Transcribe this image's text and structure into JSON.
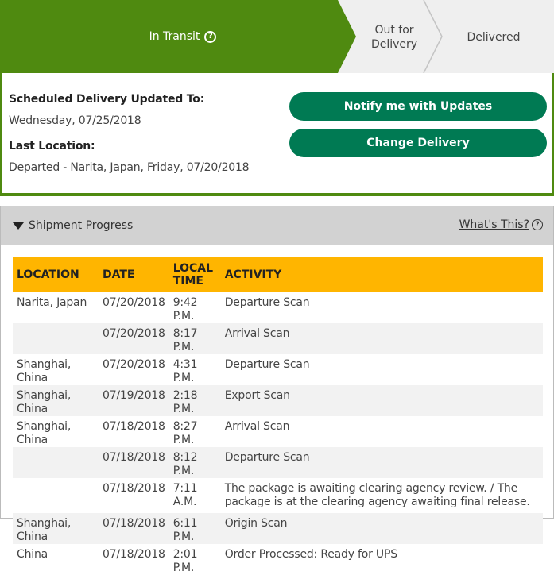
{
  "stepper": {
    "steps": [
      {
        "label": "In Transit",
        "state": "active"
      },
      {
        "label": "Out for Delivery",
        "line1": "Out for",
        "line2": "Delivery",
        "state": "pending"
      },
      {
        "label": "Delivered",
        "state": "pending"
      }
    ],
    "active_color": "#4f8a10",
    "pending_color": "#efefef"
  },
  "delivery": {
    "scheduled_label": "Scheduled Delivery Updated To:",
    "scheduled_value": "Wednesday, 07/25/2018",
    "last_location_label": "Last Location:",
    "last_location_value": "Departed - Narita, Japan, Friday, 07/20/2018",
    "notify_button": "Notify me with Updates",
    "change_button": "Change Delivery",
    "button_color": "#007a53"
  },
  "progress": {
    "title": "Shipment Progress",
    "whats_this": "What's This?",
    "columns": {
      "location": "LOCATION",
      "date": "DATE",
      "time_line1": "LOCAL",
      "time_line2": "TIME",
      "activity": "ACTIVITY"
    },
    "header_color": "#ffb500",
    "rows": [
      {
        "location": "Narita, Japan",
        "date": "07/20/2018",
        "time": "9:42 P.M.",
        "activity": "Departure Scan"
      },
      {
        "location": "",
        "date": "07/20/2018",
        "time": "8:17 P.M.",
        "activity": "Arrival Scan"
      },
      {
        "location": "Shanghai, China",
        "date": "07/20/2018",
        "time": "4:31 P.M.",
        "activity": "Departure Scan"
      },
      {
        "location": "Shanghai, China",
        "date": "07/19/2018",
        "time": "2:18 P.M.",
        "activity": "Export Scan"
      },
      {
        "location": "Shanghai, China",
        "date": "07/18/2018",
        "time": "8:27 P.M.",
        "activity": "Arrival Scan"
      },
      {
        "location": "",
        "date": "07/18/2018",
        "time": "8:12 P.M.",
        "activity": "Departure Scan"
      },
      {
        "location": "",
        "date": "07/18/2018",
        "time": "7:11 A.M.",
        "activity": "The package is awaiting clearing agency review. / The package is at the clearing agency awaiting final release."
      },
      {
        "location": "Shanghai, China",
        "date": "07/18/2018",
        "time": "6:11 P.M.",
        "activity": "Origin Scan"
      },
      {
        "location": "China",
        "date": "07/18/2018",
        "time": "2:01 P.M.",
        "activity": "Order Processed: Ready for UPS"
      }
    ]
  }
}
